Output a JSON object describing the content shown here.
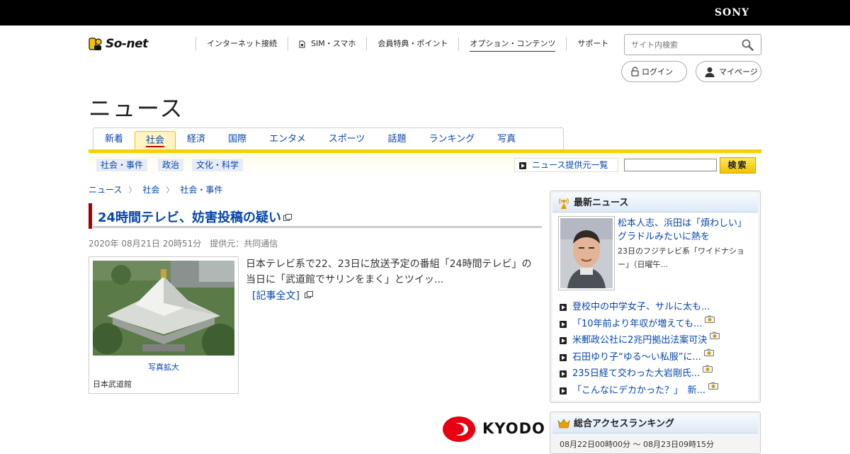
{
  "header": {
    "brand": "SONY",
    "logo_text": "So-net",
    "nav": [
      {
        "label": "インターネット接続"
      },
      {
        "label": "SIM・スマホ"
      },
      {
        "label": "会員特典・ポイント"
      },
      {
        "label": "オプション・コンテンツ"
      },
      {
        "label": "サポート"
      }
    ],
    "search_placeholder": "サイト内検索",
    "login_label": "ログイン",
    "mypage_label": "マイページ"
  },
  "page": {
    "heading": "ニュース"
  },
  "tabs": [
    {
      "label": "新着",
      "active": false
    },
    {
      "label": "社会",
      "active": true
    },
    {
      "label": "経済",
      "active": false
    },
    {
      "label": "国際",
      "active": false
    },
    {
      "label": "エンタメ",
      "active": false
    },
    {
      "label": "スポーツ",
      "active": false
    },
    {
      "label": "話題",
      "active": false
    },
    {
      "label": "ランキング",
      "active": false
    },
    {
      "label": "写真",
      "active": false
    }
  ],
  "subnav": {
    "tags": [
      "社会・事件",
      "政治",
      "文化・科学"
    ],
    "source_link": "ニュース提供元一覧",
    "search_button": "検索"
  },
  "breadcrumb": [
    "ニュース",
    "社会",
    "社会・事件"
  ],
  "article": {
    "title": "24時間テレビ、妨害投稿の疑い",
    "meta": "2020年 08月21日 20時51分　提供元：共同通信",
    "lead": "日本テレビ系で22、23日に放送予定の番組「24時間テレビ」の当日に「武道館でサリンをまく」とツイッ...",
    "fulltext_link": "[記事全文]",
    "photo_enlarge": "写真拡大",
    "photo_caption": "日本武道館",
    "provider_logo": "KYODO"
  },
  "sidebar": {
    "latest": {
      "heading": "最新ニュース",
      "feature": {
        "title": "松本人志、浜田は「煩わしい」グラドルみたいに熱を",
        "summary": "23日のフジテレビ系「ワイドナショー」（日曜午..."
      },
      "items": [
        {
          "title": "登校中の中学女子、サルに太も...",
          "camera": false
        },
        {
          "title": "「10年前より年収が増えても...",
          "camera": true
        },
        {
          "title": "米郵政公社に2兆円拠出法案可決",
          "camera": true
        },
        {
          "title": "石田ゆり子“ゆる～い私服”に...",
          "camera": true
        },
        {
          "title": "235日経て交わった大岩剛氏...",
          "camera": true
        },
        {
          "title": "「こんなにデカかった？」　新...",
          "camera": true
        }
      ]
    },
    "ranking": {
      "heading": "総合アクセスランキング",
      "period": "08月22日00時00分 ～ 08月23日09時15分"
    }
  },
  "colors": {
    "link": "#0645ad",
    "accent_yellow": "#f6d000",
    "title_bar": "#a40000",
    "kyodo_red": "#e60012"
  }
}
